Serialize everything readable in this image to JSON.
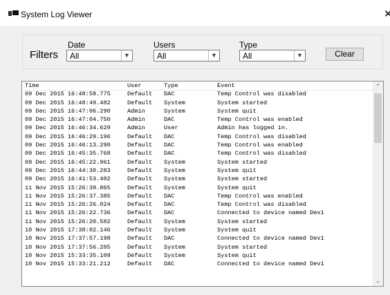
{
  "window": {
    "title": "System Log Viewer",
    "close_glyph": "✕"
  },
  "filters": {
    "label": "Filters",
    "date": {
      "label": "Date",
      "value": "All"
    },
    "users": {
      "label": "Users",
      "value": "All"
    },
    "type": {
      "label": "Type",
      "value": "All"
    },
    "clear_label": "Clear"
  },
  "log": {
    "headers": [
      "Time",
      "User",
      "Type",
      "Event"
    ],
    "rows": [
      [
        "09 Dec 2015 16:48:58.775",
        "Default",
        "DAC",
        "Temp Control was disabled"
      ],
      [
        "09 Dec 2015 16:48:49.482",
        "Default",
        "System",
        "System started"
      ],
      [
        "09 Dec 2015 16:47:06.290",
        "Admin",
        "System",
        "System quit"
      ],
      [
        "09 Dec 2015 16:47:04.750",
        "Admin",
        "DAC",
        "Temp Control was enabled"
      ],
      [
        "09 Dec 2015 16:46:34.629",
        "Admin",
        "User",
        "Admin has logged in."
      ],
      [
        "09 Dec 2015 16:46:29.196",
        "Default",
        "DAC",
        "Temp Control was disabled"
      ],
      [
        "09 Dec 2015 16:46:13.290",
        "Default",
        "DAC",
        "Temp Control was enabled"
      ],
      [
        "09 Dec 2015 16:45:35.768",
        "Default",
        "DAC",
        "Temp Control was disabled"
      ],
      [
        "09 Dec 2015 16:45:22.961",
        "Default",
        "System",
        "System started"
      ],
      [
        "09 Dec 2015 16:44:30.283",
        "Default",
        "System",
        "System quit"
      ],
      [
        "09 Dec 2015 16:41:53.402",
        "Default",
        "System",
        "System started"
      ],
      [
        "11 Nov 2015 15:26:39.865",
        "Default",
        "System",
        "System quit"
      ],
      [
        "11 Nov 2015 15:26:37.385",
        "Default",
        "DAC",
        "Temp Control was enabled"
      ],
      [
        "11 Nov 2015 15:26:26.024",
        "Default",
        "DAC",
        "Temp Control was disabled"
      ],
      [
        "11 Nov 2015 15:26:22.736",
        "Default",
        "DAC",
        "Connected to device named Dev1"
      ],
      [
        "11 Nov 2015 15:26:20.582",
        "Default",
        "System",
        "System started"
      ],
      [
        "10 Nov 2015 17:38:02.146",
        "Default",
        "System",
        "System quit"
      ],
      [
        "10 Nov 2015 17:37:57.198",
        "Default",
        "DAC",
        "Connected to device named Dev1"
      ],
      [
        "10 Nov 2015 17:37:56.205",
        "Default",
        "System",
        "System started"
      ],
      [
        "10 Nov 2015 15:33:35.109",
        "Default",
        "System",
        "System quit"
      ],
      [
        "10 Nov 2015 15:33:21.212",
        "Default",
        "DAC",
        "Connected to device named Dev1"
      ]
    ]
  },
  "scrollbar": {
    "up_glyph": "⌃",
    "down_glyph": "⌄"
  }
}
